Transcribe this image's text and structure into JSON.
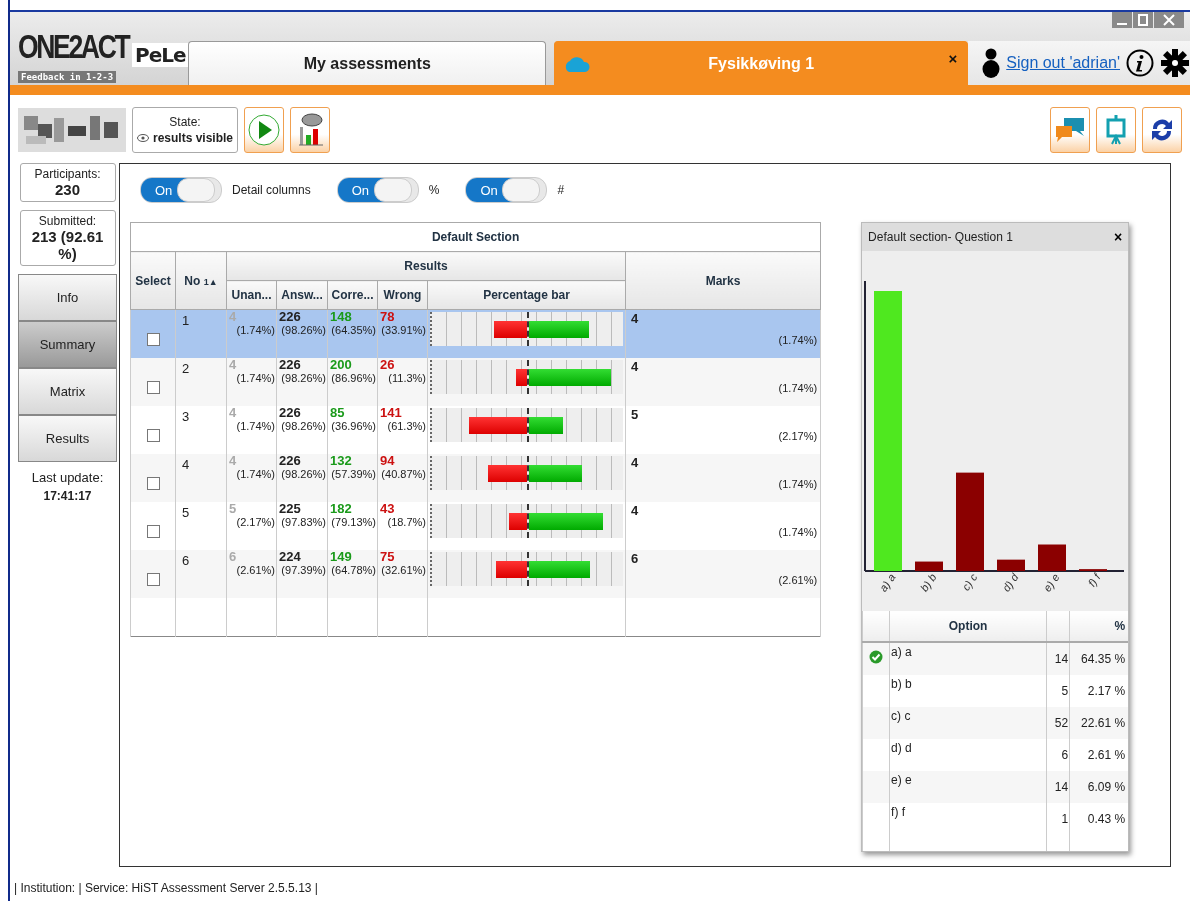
{
  "logo": {
    "brand": "ONE2ACT",
    "tagline": "Feedback in 1-2-3",
    "product": "PeLe"
  },
  "tabs": [
    {
      "label": "My assessments",
      "selected": false
    },
    {
      "label": "Fysikkøving 1",
      "selected": true,
      "close": "×"
    }
  ],
  "user": {
    "sign_out": "Sign out 'adrian'"
  },
  "toolbar": {
    "state_label": "State:",
    "state_value": "results visible"
  },
  "stats": {
    "participants_label": "Participants:",
    "participants": "230",
    "submitted_label": "Submitted:",
    "submitted": "213 (92.61 %)"
  },
  "nav": [
    {
      "label": "Info",
      "selected": false
    },
    {
      "label": "Summary",
      "selected": true
    },
    {
      "label": "Matrix",
      "selected": false
    },
    {
      "label": "Results",
      "selected": false
    }
  ],
  "last_update": {
    "label": "Last update:",
    "time": "17:41:17"
  },
  "toggles": [
    {
      "switch": "On",
      "on": true,
      "label": "Detail columns"
    },
    {
      "switch": "On",
      "on": true,
      "label": "%"
    },
    {
      "switch": "On",
      "on": true,
      "label": "#"
    }
  ],
  "table": {
    "section": "Default Section",
    "group": "Results",
    "columns": {
      "select": "Select",
      "no": "No",
      "sort": "1▲",
      "unanswered": "Unan...",
      "answered": "Answ...",
      "correct": "Corre...",
      "wrong": "Wrong",
      "bar": "Percentage bar",
      "marks": "Marks"
    },
    "rows": [
      {
        "selected": true,
        "checked": false,
        "no": "1",
        "unanswered": "4",
        "unanswered_pct": "(1.74%)",
        "answered": "226",
        "answered_pct": "(98.26%)",
        "correct": "148",
        "correct_pct": "(64.35%)",
        "wrong": "78",
        "wrong_pct": "(33.91%)",
        "correct_bar": {
          "level": 0.64
        },
        "marks": "4",
        "marks_pct": "(1.74%)"
      },
      {
        "selected": false,
        "checked": false,
        "no": "2",
        "unanswered": "4",
        "unanswered_pct": "(1.74%)",
        "answered": "226",
        "answered_pct": "(98.26%)",
        "correct": "200",
        "correct_pct": "(86.96%)",
        "wrong": "26",
        "wrong_pct": "(11.3%)",
        "correct_bar": {
          "level": 0.87
        },
        "marks": "4",
        "marks_pct": "(1.74%)"
      },
      {
        "selected": false,
        "checked": false,
        "no": "3",
        "unanswered": "4",
        "unanswered_pct": "(1.74%)",
        "answered": "226",
        "answered_pct": "(98.26%)",
        "correct": "85",
        "correct_pct": "(36.96%)",
        "wrong": "141",
        "wrong_pct": "(61.3%)",
        "correct_bar": {
          "level": 0.37
        },
        "marks": "5",
        "marks_pct": "(2.17%)"
      },
      {
        "selected": false,
        "checked": false,
        "no": "4",
        "unanswered": "4",
        "unanswered_pct": "(1.74%)",
        "answered": "226",
        "answered_pct": "(98.26%)",
        "correct": "132",
        "correct_pct": "(57.39%)",
        "wrong": "94",
        "wrong_pct": "(40.87%)",
        "correct_bar": {
          "level": 0.57
        },
        "marks": "4",
        "marks_pct": "(1.74%)"
      },
      {
        "selected": false,
        "checked": false,
        "no": "5",
        "unanswered": "5",
        "unanswered_pct": "(2.17%)",
        "answered": "225",
        "answered_pct": "(97.83%)",
        "correct": "182",
        "correct_pct": "(79.13%)",
        "wrong": "43",
        "wrong_pct": "(18.7%)",
        "correct_bar": {
          "level": 0.79
        },
        "marks": "4",
        "marks_pct": "(1.74%)"
      },
      {
        "selected": false,
        "checked": false,
        "no": "6",
        "unanswered": "6",
        "unanswered_pct": "(2.61%)",
        "answered": "224",
        "answered_pct": "(97.39%)",
        "correct": "149",
        "correct_pct": "(64.78%)",
        "wrong": "75",
        "wrong_pct": "(32.61%)",
        "correct_bar": {
          "level": 0.65
        },
        "marks": "6",
        "marks_pct": "(2.61%)"
      }
    ]
  },
  "question_panel": {
    "title": "Default section- Question 1",
    "close": "×",
    "chart_labels": [
      "a) a",
      "b) b",
      "c) c",
      "d) d",
      "e) e",
      "f) f"
    ],
    "columns": {
      "option": "Option",
      "percent": "%"
    },
    "options": [
      {
        "label": "a) a",
        "count": "14",
        "percent": "64.35 %",
        "correct": true
      },
      {
        "label": "b) b",
        "count": "5",
        "percent": "2.17 %",
        "correct": false
      },
      {
        "label": "c) c",
        "count": "52",
        "percent": "22.61 %",
        "correct": false
      },
      {
        "label": "d) d",
        "count": "6",
        "percent": "2.61 %",
        "correct": false
      },
      {
        "label": "e) e",
        "count": "14",
        "percent": "6.09 %",
        "correct": false
      },
      {
        "label": "f) f",
        "count": "1",
        "percent": "0.43 %",
        "correct": false
      }
    ]
  },
  "footer": "| Institution:  | Service: HiST Assessment Server  2.5.5.13 |"
}
